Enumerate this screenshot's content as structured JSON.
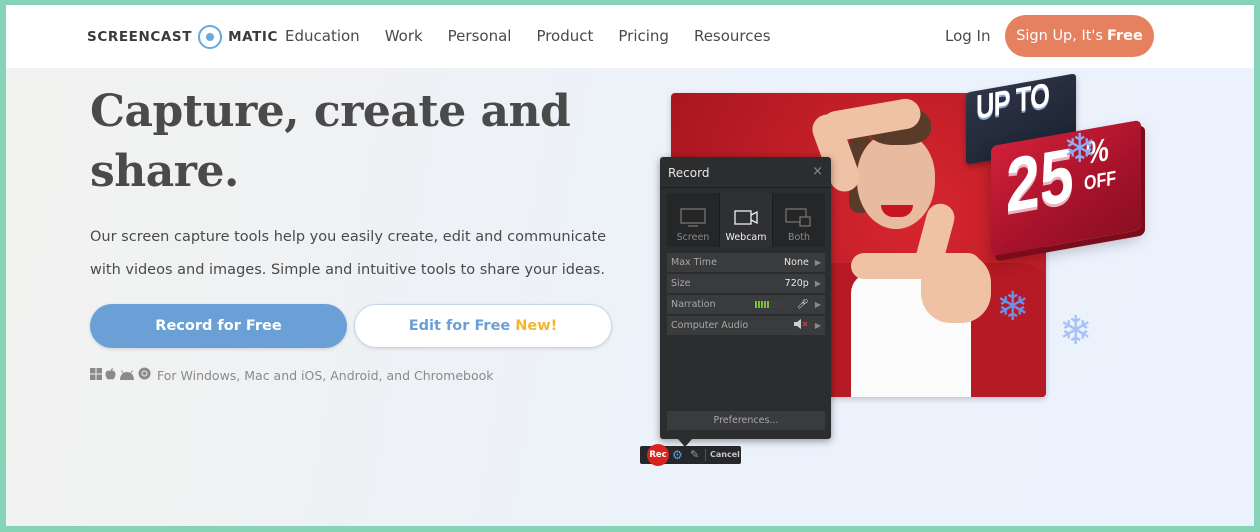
{
  "header": {
    "logo_left": "SCREENCAST",
    "logo_right": "MATIC",
    "nav": [
      {
        "label": "Education"
      },
      {
        "label": "Work"
      },
      {
        "label": "Personal"
      },
      {
        "label": "Product"
      },
      {
        "label": "Pricing"
      },
      {
        "label": "Resources"
      }
    ],
    "login_label": "Log In",
    "signup_prefix": "Sign Up, It's",
    "signup_bold": "Free"
  },
  "hero": {
    "headline_line1": "Capture, create and",
    "headline_line2": "share.",
    "subtext": "Our screen capture tools help you easily create, edit and communicate with videos and images. Simple and intuitive tools to share your ideas.",
    "record_button": "Record for Free",
    "edit_button": "Edit for Free",
    "edit_badge": "New!",
    "platform_icons": [
      "windows-icon",
      "apple-icon",
      "android-icon",
      "chrome-icon"
    ],
    "platforms_text": "For Windows, Mac and iOS, Android, and Chromebook"
  },
  "promo": {
    "line1": "UP TO",
    "amount": "25",
    "percent": "%",
    "off": "OFF"
  },
  "recorder": {
    "title": "Record",
    "close": "×",
    "modes": [
      {
        "label": "Screen",
        "icon": "monitor-icon",
        "active": false
      },
      {
        "label": "Webcam",
        "icon": "webcam-icon",
        "active": true
      },
      {
        "label": "Both",
        "icon": "screen-webcam-icon",
        "active": false
      }
    ],
    "settings": [
      {
        "key": "Max Time",
        "value": "None"
      },
      {
        "key": "Size",
        "value": "720p"
      },
      {
        "key": "Narration",
        "value": "",
        "meter_level": 0.45
      },
      {
        "key": "Computer Audio",
        "value": ""
      }
    ],
    "preferences": "Preferences...",
    "rec_label": "Rec",
    "cancel_label": "Cancel"
  },
  "colors": {
    "accent_blue": "#6aa0d6",
    "signup_orange": "#e5815f",
    "new_yellow": "#f2b630",
    "frame_green": "#86d4b8"
  }
}
